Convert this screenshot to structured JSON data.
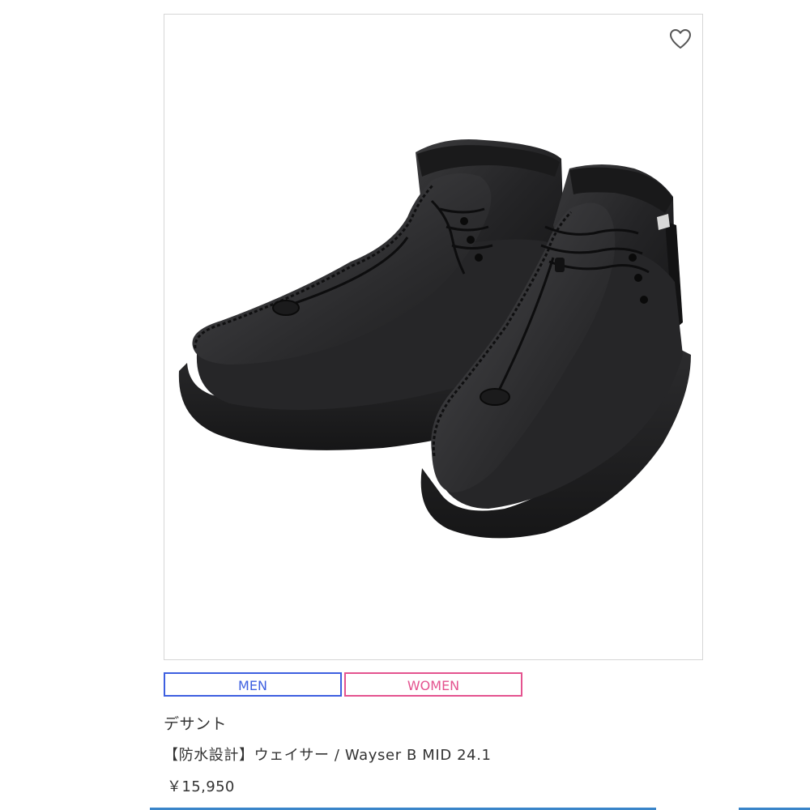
{
  "product": {
    "brand": "デサント",
    "name": "【防水設計】ウェイサー / Wayser B MID 24.1",
    "price": "￥15,950",
    "image_alt": "Black mid-cut waterproof moc-toe boots with bungee laces",
    "favorite_icon": "heart-outline-icon"
  },
  "tags": {
    "men": "MEN",
    "women": "WOMEN"
  },
  "colors": {
    "men_tag": "#3d5fe0",
    "women_tag": "#e4538f",
    "border": "#d6d6d6",
    "text": "#333333",
    "bottom_accent": "#3a85c9"
  }
}
